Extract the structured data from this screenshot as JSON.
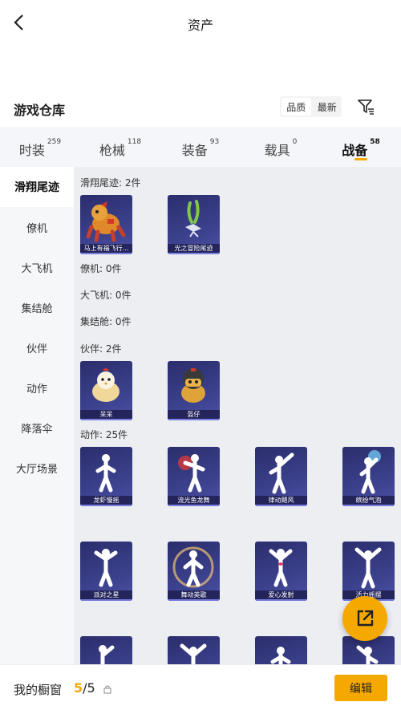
{
  "header": {
    "title": "资产"
  },
  "section": {
    "title": "游戏仓库",
    "sort_quality": "品质",
    "sort_latest": "最新"
  },
  "tabs": [
    {
      "label": "时装",
      "count": "259"
    },
    {
      "label": "枪械",
      "count": "118"
    },
    {
      "label": "装备",
      "count": "93"
    },
    {
      "label": "载具",
      "count": "0"
    },
    {
      "label": "战备",
      "count": "58"
    }
  ],
  "sidebar": [
    "滑翔尾迹",
    "僚机",
    "大飞机",
    "集结舱",
    "伙伴",
    "动作",
    "降落伞",
    "大厅场景"
  ],
  "groups": {
    "glide": {
      "label": "滑翔尾迹: 2件",
      "items": [
        "马上有福飞行...",
        "光之冒险尾迹"
      ]
    },
    "wingman": {
      "label": "僚机: 0件"
    },
    "plane": {
      "label": "大飞机: 0件"
    },
    "pod": {
      "label": "集结舱: 0件"
    },
    "partner": {
      "label": "伙伴: 2件",
      "items": [
        "呆呆",
        "盔仔"
      ]
    },
    "emote": {
      "label": "动作: 25件",
      "items": [
        "龙虾慢摇",
        "流光鱼龙舞",
        "律动飓风",
        "缤纷气泡",
        "派对之星",
        "舞动英歌",
        "爱心发射",
        "活力摇摆"
      ]
    }
  },
  "bottom": {
    "label": "我的橱窗",
    "current": "5",
    "sep_total": "/5",
    "edit": "编辑"
  },
  "colors": {
    "accent": "#f5a800",
    "card": "#3a3f8a"
  }
}
